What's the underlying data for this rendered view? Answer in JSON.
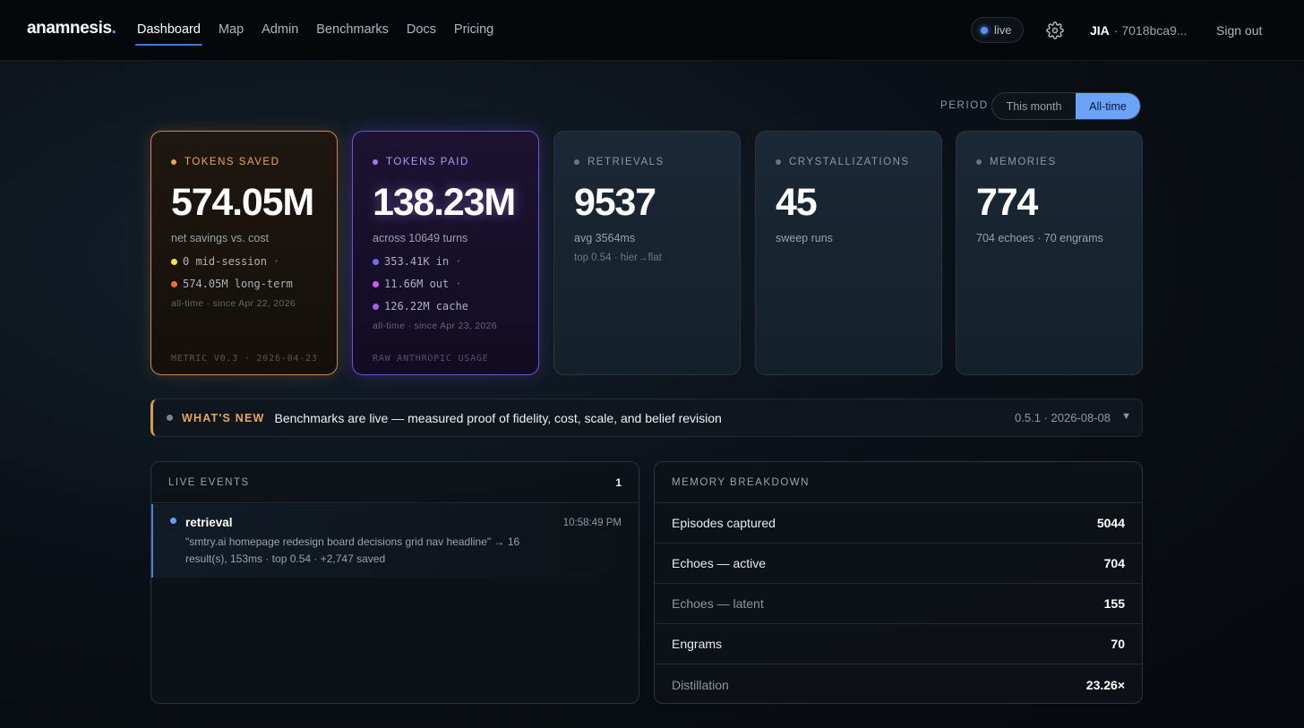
{
  "nav": {
    "logo_text": "anamnesis",
    "logo_dot": ".",
    "items": [
      {
        "label": "Dashboard",
        "active": true
      },
      {
        "label": "Map"
      },
      {
        "label": "Admin"
      },
      {
        "label": "Benchmarks"
      },
      {
        "label": "Docs"
      },
      {
        "label": "Pricing"
      }
    ],
    "live_label": "live",
    "settings_icon": "gear-icon",
    "user_name": "JIA",
    "user_id": "· 7018bca9...",
    "sign_out": "Sign out"
  },
  "period": {
    "label": "PERIOD",
    "options": [
      "This month",
      "All-time"
    ],
    "selected": "All-time"
  },
  "cards": {
    "saved": {
      "title": "TOKENS SAVED",
      "value": "574.05M",
      "sub": "net savings vs. cost",
      "line1": "0 mid-session",
      "line1_sep": "·",
      "line2": "574.05M long-term",
      "since": "all-time · since Apr 22, 2026",
      "foot": "METRIC V0.3 · 2026-04-23"
    },
    "paid": {
      "title": "TOKENS PAID",
      "value": "138.23M",
      "sub": "across 10649 turns",
      "line1": "353.41K in",
      "line1_sep": "·",
      "line2": "11.66M out",
      "line2_sep": "·",
      "line3": "126.22M cache",
      "since": "all-time · since Apr 23, 2026",
      "foot": "RAW ANTHROPIC USAGE"
    },
    "retrievals": {
      "title": "RETRIEVALS",
      "value": "9537",
      "sub": "avg 3564ms",
      "detail": "top 0.54 · hier→flat"
    },
    "crystallizations": {
      "title": "CRYSTALLIZATIONS",
      "value": "45",
      "sub": "sweep runs"
    },
    "memories": {
      "title": "MEMORIES",
      "value": "774",
      "sub": "704 echoes · 70 engrams"
    }
  },
  "colors": {
    "saved_accent": "#e8a65c",
    "paid_accent": "#a679f0",
    "live_dot": "#5b8ff2",
    "dot_yellow": "#f4e04d",
    "dot_orange": "#ef6a3c",
    "dot_indigo": "#6f6bf2",
    "dot_magenta": "#cf5ce6",
    "dot_violet": "#9b62ea"
  },
  "banner": {
    "tag": "WHAT'S NEW",
    "message": "Benchmarks are live — measured proof of fidelity, cost, scale, and belief revision",
    "version": "0.5.1 · 2026-08-08",
    "chevron": "▼"
  },
  "live_events": {
    "title": "LIVE EVENTS",
    "count": "1",
    "events": [
      {
        "type": "retrieval",
        "time": "10:58:49 PM",
        "text": "\"smtry.ai homepage redesign board decisions grid nav headline\" → 16 result(s), 153ms · top 0.54 · +2,747 saved"
      }
    ]
  },
  "breakdown": {
    "title": "MEMORY BREAKDOWN",
    "rows": [
      {
        "label": "Episodes captured",
        "value": "5044"
      },
      {
        "label": "Echoes — active",
        "value": "704"
      },
      {
        "label": "Echoes — latent",
        "value": "155"
      },
      {
        "label": "Engrams",
        "value": "70"
      },
      {
        "label": "Distillation",
        "value": "23.26×"
      }
    ]
  }
}
